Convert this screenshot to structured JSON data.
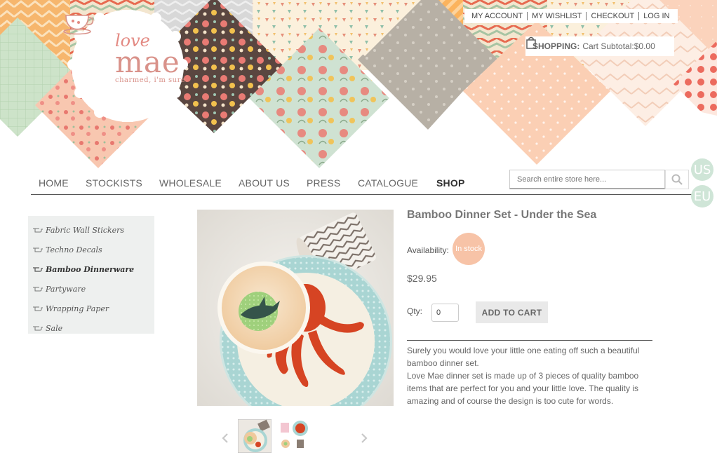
{
  "brand": {
    "love": "love",
    "name": "mae",
    "tagline": "charmed, i'm sure."
  },
  "toplinks": {
    "my_account": "MY ACCOUNT",
    "my_wishlist": "MY WISHLIST",
    "checkout": "CHECKOUT",
    "log_in": "LOG IN"
  },
  "cart": {
    "label": "SHOPPING:",
    "subtotal": "Cart Subtotal:$0.00"
  },
  "nav": {
    "items": [
      "HOME",
      "STOCKISTS",
      "WHOLESALE",
      "ABOUT US",
      "PRESS",
      "CATALOGUE",
      "SHOP"
    ],
    "active": "SHOP"
  },
  "search": {
    "placeholder": "Search entire store here..."
  },
  "stores": {
    "us": "US",
    "eu": "EU"
  },
  "sidebar": {
    "items": [
      "Fabric Wall Stickers",
      "Techno Decals",
      "Bamboo Dinnerware",
      "Partyware",
      "Wrapping Paper",
      "Sale"
    ],
    "current": "Bamboo Dinnerware"
  },
  "product": {
    "title": "Bamboo Dinner Set - Under the Sea",
    "availability_label": "Availability:",
    "stock_status": "In stock",
    "price": "$29.95",
    "qty_label": "Qty:",
    "qty_value": "0",
    "add_to_cart": "ADD TO CART",
    "description": [
      "Surely you would love your little one eating off such a beautiful bamboo dinner set.",
      "Love Mae dinner set is made up of 3 pieces of quality bamboo items that are perfect for you and your little love. The quality is amazing and of course the design is too cute for words."
    ]
  },
  "colors": {
    "accent_peach": "#f7c3a7",
    "logo_pink": "#d9928a",
    "sidebar_bg": "#eef0ef",
    "store_green": "#cfe5d7"
  }
}
